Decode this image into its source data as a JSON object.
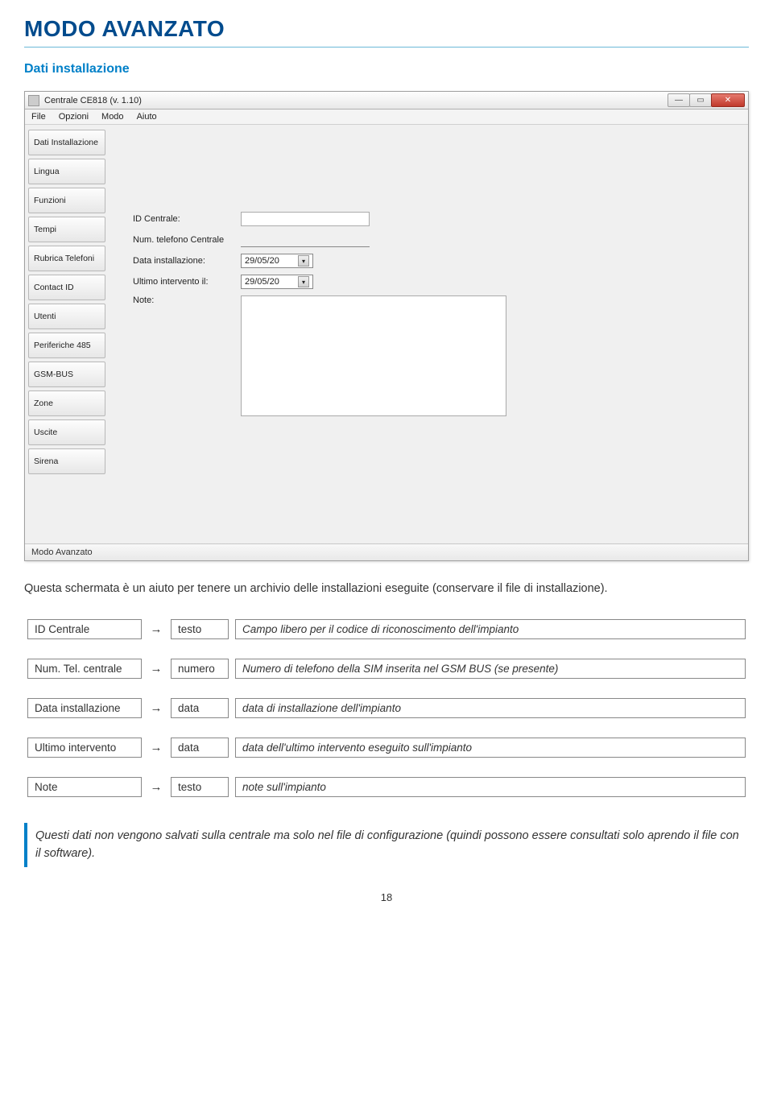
{
  "doc": {
    "title": "MODO AVANZATO",
    "section_head": "Dati installazione",
    "intro": "Questa schermata è un aiuto per tenere un archivio delle installazioni eseguite (conservare il file di installazione).",
    "note_block": "Questi dati non vengono salvati sulla centrale ma solo nel file di configurazione (quindi possono essere consultati solo aprendo il file con il software).",
    "page_number": "18"
  },
  "window": {
    "title": "Centrale CE818 (v. 1.10)",
    "menu": [
      "File",
      "Opzioni",
      "Modo",
      "Aiuto"
    ],
    "side_tabs": [
      "Dati Installazione",
      "Lingua",
      "Funzioni",
      "Tempi",
      "Rubrica Telefoni",
      "Contact ID",
      "Utenti",
      "Periferiche 485",
      "GSM-BUS",
      "Zone",
      "Uscite",
      "Sirena"
    ],
    "form": {
      "id_label": "ID Centrale:",
      "tel_label": "Num. telefono Centrale",
      "data_inst_label": "Data installazione:",
      "ultimo_label": "Ultimo intervento il:",
      "note_label": "Note:",
      "date_value": "29/05/20"
    },
    "status": "Modo Avanzato"
  },
  "mapping": [
    {
      "name": "ID Centrale",
      "type": "testo",
      "desc": "Campo libero per il codice di riconoscimento dell'impianto"
    },
    {
      "name": "Num. Tel. centrale",
      "type": "numero",
      "desc": "Numero di telefono della SIM inserita nel GSM BUS (se presente)"
    },
    {
      "name": "Data installazione",
      "type": "data",
      "desc": "data di installazione dell'impianto"
    },
    {
      "name": "Ultimo intervento",
      "type": "data",
      "desc": "data dell'ultimo intervento eseguito sull'impianto"
    },
    {
      "name": "Note",
      "type": "testo",
      "desc": "note sull'impianto"
    }
  ],
  "arrow": "→"
}
